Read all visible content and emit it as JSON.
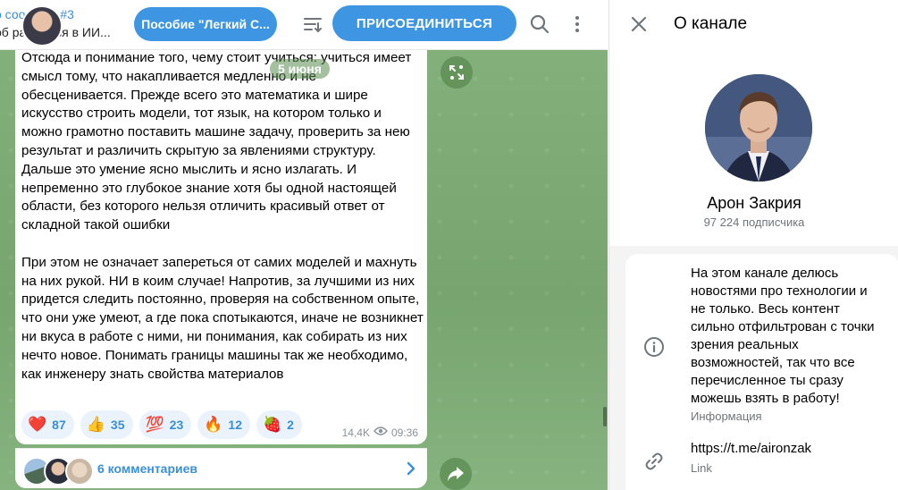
{
  "header": {
    "title": "о соо...ние #3",
    "subtitle": "об ра...аться в ИИ...",
    "pinned_label": "Пособие \"Легкий С...",
    "join_label": "ПРИСОЕДИНИТЬСЯ"
  },
  "post": {
    "date": "5 июня",
    "paragraphs": [
      "Отсюда и понимание того, чему стоит учиться: учиться имеет смысл тому, что накапливается медленно и не обесценивается. Прежде всего это математика и шире искусство строить модели, тот язык, на котором только и можно грамотно поставить машине задачу, проверить за нею результат и различить скрытую за явлениями структуру. Дальше это умение ясно мыслить и ясно излагать. И непременно это глубокое знание хотя бы одной настоящей области, без которого нельзя отличить красивый ответ от складной такой ошибки",
      "При этом не означает запереться от самих моделей и махнуть на них рукой. НИ в коим случае! Напротив, за лучшими из них придется следить постоянно, проверяя на собственном опыте, что они уже умеют, а где пока спотыкаются, иначе не возникнет ни вкуса в работе с ними, ни понимания, как собирать из них нечто новое. Понимать границы машины так же необходимо, как инженеру знать свойства материалов"
    ],
    "reactions": [
      {
        "emoji": "❤️",
        "count": "87"
      },
      {
        "emoji": "👍",
        "count": "35"
      },
      {
        "emoji": "💯",
        "count": "23"
      },
      {
        "emoji": "🔥",
        "count": "12"
      },
      {
        "emoji": "🍓",
        "count": "2"
      }
    ],
    "views": "14,4K",
    "time": "09:36",
    "comments_label": "6 комментариев"
  },
  "panel": {
    "title": "О канале",
    "name": "Арон Закрия",
    "subscribers": "97 224 подписчика",
    "description": "На этом канале делюсь новостями про технологии и не только. Весь контент сильно отфильтрован с точки зрения реальных возможностей, так что все перечисленное ты сразу можешь взять в работу!",
    "description_label": "Информация",
    "link": "https://t.me/aironzak",
    "link_label": "Link"
  },
  "colors": {
    "accent": "#3e96e2",
    "chat_bg": "#7ba874",
    "reaction_bg": "#eaf2fb"
  },
  "icons": [
    "filter-icon",
    "search-icon",
    "more-icon",
    "close-icon",
    "info-icon",
    "link-icon",
    "share-icon",
    "comments-arrow-icon",
    "eye-icon",
    "scroll-down-icon"
  ]
}
